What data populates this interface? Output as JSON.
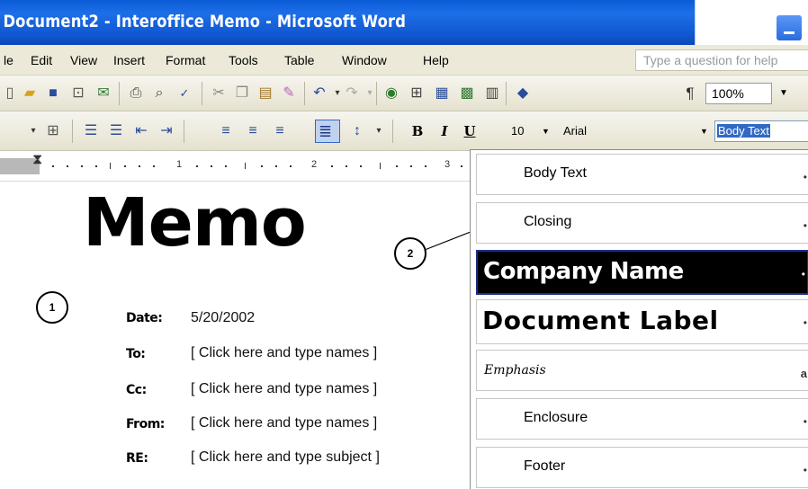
{
  "window": {
    "title": "Document2 - Interoffice Memo - Microsoft Word"
  },
  "menu": {
    "items": [
      "le",
      "Edit",
      "View",
      "Insert",
      "Format",
      "Tools",
      "Table",
      "Window",
      "Help"
    ],
    "ask_placeholder": "Type a question for help"
  },
  "standard_toolbar": {
    "zoom": "100%"
  },
  "formatting_toolbar": {
    "bold": "B",
    "italic": "I",
    "underline": "U",
    "font_size": "10",
    "font_name": "Arial",
    "style": "Body Text"
  },
  "ruler": {
    "numbers": [
      "1",
      "2",
      "3"
    ]
  },
  "document": {
    "title": "Memo",
    "fields": [
      {
        "label": "Date:",
        "value": "5/20/2002"
      },
      {
        "label": "To:",
        "value": "[  Click here and type names  ]"
      },
      {
        "label": "Cc:",
        "value": "[  Click here and type names  ]"
      },
      {
        "label": "From:",
        "value": "[  Click here and type names  ]"
      },
      {
        "label": "RE:",
        "value": "[  Click here and type subject  ]"
      }
    ]
  },
  "callouts": [
    "1",
    "2"
  ],
  "style_dropdown": {
    "items": [
      "Body Text",
      "Closing",
      "Company Name",
      "Document Label",
      "Emphasis",
      "Enclosure",
      "Footer"
    ],
    "selected": "Company Name"
  }
}
